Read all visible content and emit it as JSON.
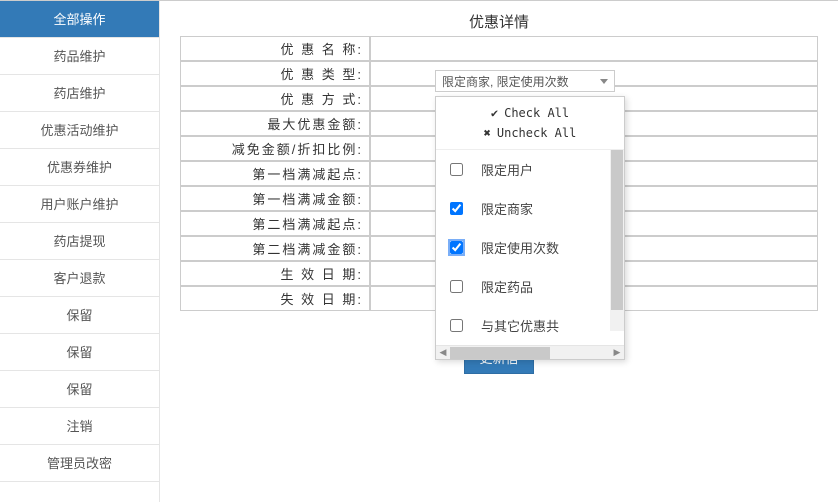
{
  "sidebar": {
    "items": [
      {
        "label": "全部操作",
        "active": true
      },
      {
        "label": "药品维护"
      },
      {
        "label": "药店维护"
      },
      {
        "label": "优惠活动维护"
      },
      {
        "label": "优惠券维护"
      },
      {
        "label": "用户账户维护"
      },
      {
        "label": "药店提现"
      },
      {
        "label": "客户退款"
      },
      {
        "label": "保留"
      },
      {
        "label": "保留"
      },
      {
        "label": "保留"
      },
      {
        "label": "注销"
      },
      {
        "label": "管理员改密"
      }
    ]
  },
  "page": {
    "title": "优惠详情"
  },
  "form": {
    "rows": [
      {
        "label": "优 惠 名 称:"
      },
      {
        "label": "优 惠 类 型:"
      },
      {
        "label": "优 惠 方 式:"
      },
      {
        "label": "最大优惠金额:"
      },
      {
        "label": "减免金额/折扣比例:"
      },
      {
        "label": "第一档满减起点:"
      },
      {
        "label": "第一档满减金额:"
      },
      {
        "label": "第二档满减起点:"
      },
      {
        "label": "第二档满减金额:"
      },
      {
        "label": "生 效 日 期:"
      },
      {
        "label": "失 效 日 期:"
      }
    ]
  },
  "combo": {
    "selected": "限定商家, 限定使用次数"
  },
  "dropdown": {
    "check_all": "Check All",
    "uncheck_all": "Uncheck All",
    "options": [
      {
        "label": "限定用户",
        "checked": false
      },
      {
        "label": "限定商家",
        "checked": true
      },
      {
        "label": "限定使用次数",
        "checked": true,
        "focused": true
      },
      {
        "label": "限定药品",
        "checked": false
      },
      {
        "label": "与其它优惠共",
        "checked": false
      }
    ]
  },
  "buttons": {
    "submit": "更新信"
  }
}
